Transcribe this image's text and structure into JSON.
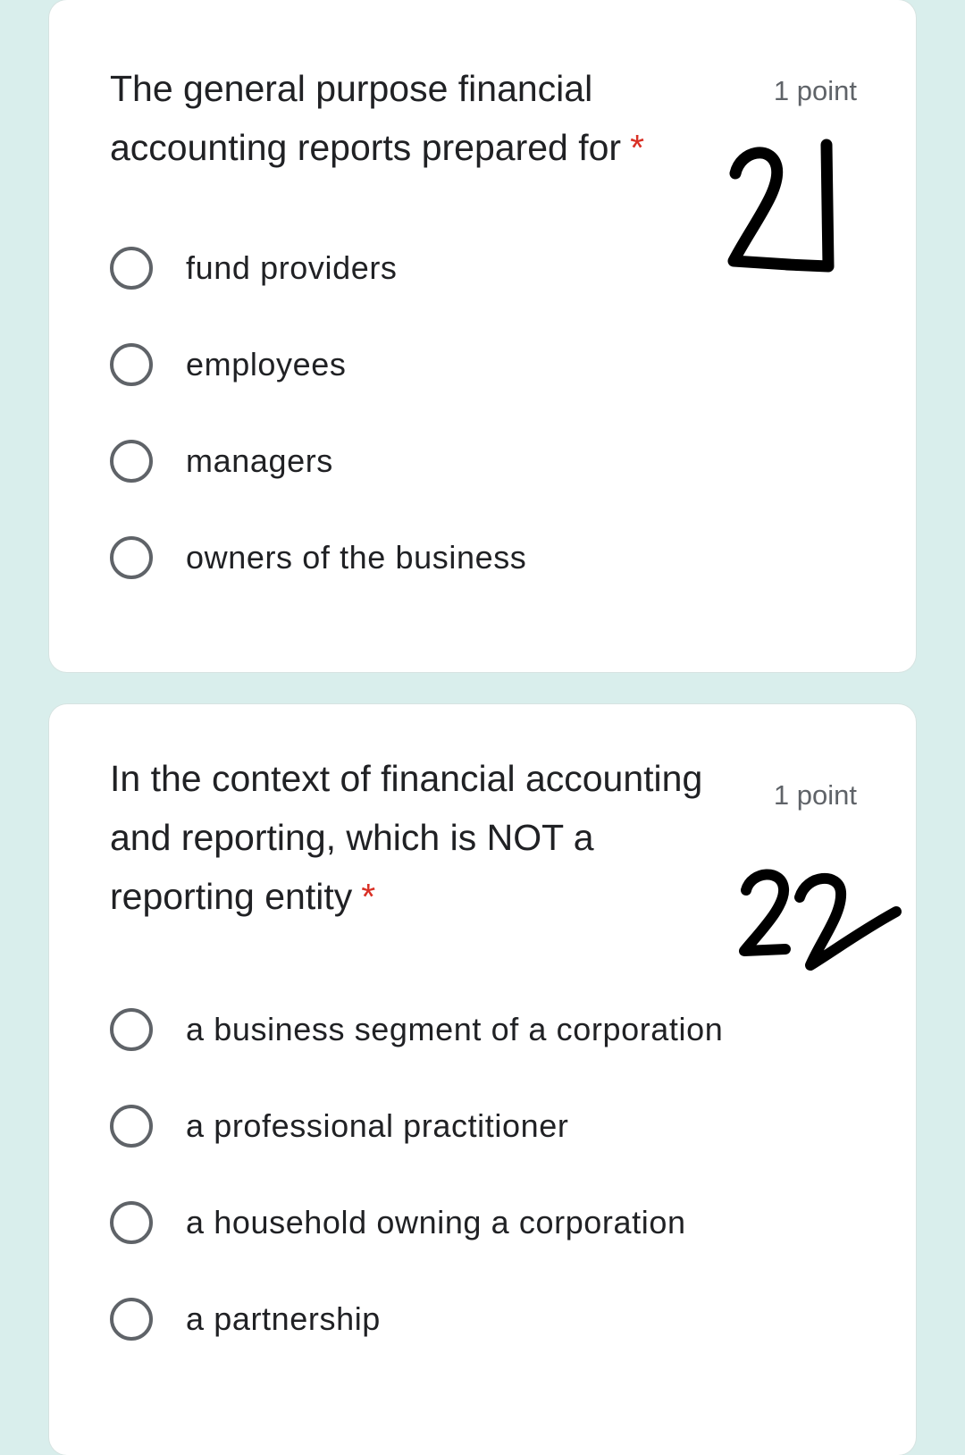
{
  "questions": [
    {
      "title": "The general purpose financial accounting reports prepared for",
      "required_mark": "*",
      "points": "1 point",
      "handwritten_number": "21",
      "options": [
        {
          "label": "fund providers",
          "selected": false
        },
        {
          "label": "employees",
          "selected": false
        },
        {
          "label": "managers",
          "selected": false
        },
        {
          "label": "owners of the business",
          "selected": false
        }
      ]
    },
    {
      "title": "In the context of financial accounting and reporting, which is NOT a reporting entity",
      "required_mark": "*",
      "points": "1 point",
      "handwritten_number": "22",
      "options": [
        {
          "label": "a business segment of a corporation",
          "selected": false
        },
        {
          "label": "a professional practitioner",
          "selected": false
        },
        {
          "label": "a household owning a corporation",
          "selected": false
        },
        {
          "label": "a partnership",
          "selected": false
        }
      ]
    }
  ],
  "colors": {
    "page_background": "#d9eeec",
    "card_background": "#ffffff",
    "required_asterisk": "#d93025",
    "points_text": "#5f6368",
    "radio_border": "#5f6368"
  },
  "icons": {
    "radio_unselected": "radio-button-unchecked-icon"
  }
}
